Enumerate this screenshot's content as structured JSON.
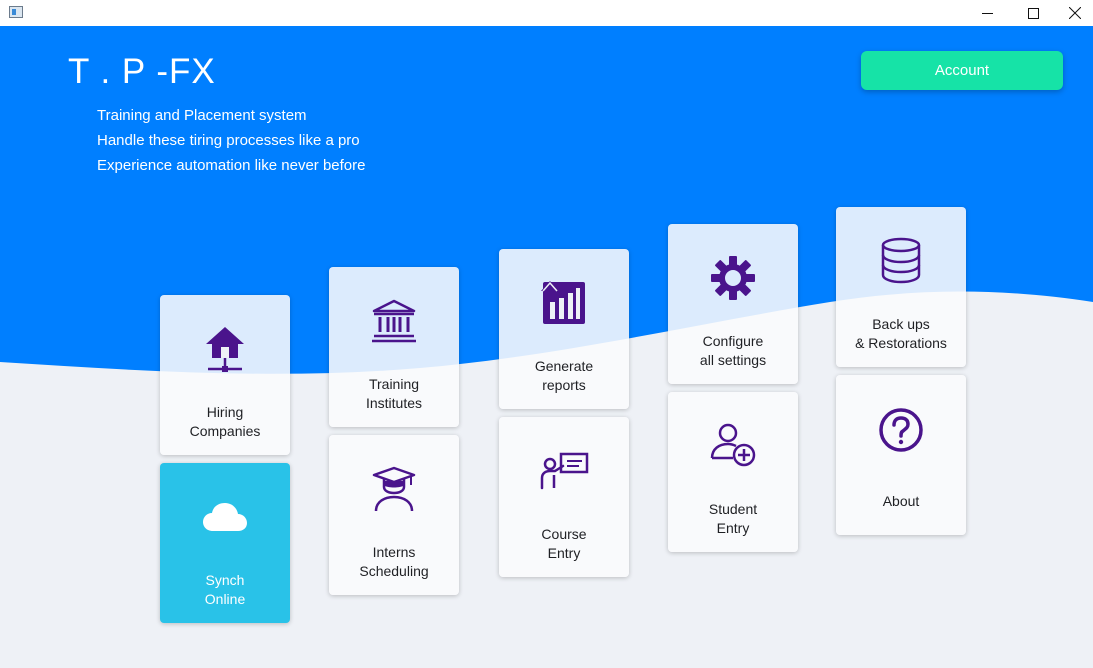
{
  "window": {
    "controls": [
      "minimize",
      "maximize",
      "close"
    ]
  },
  "header": {
    "brand": "T . P -FX",
    "taglines": [
      "Training and Placement system",
      "Handle these tiring processes like a pro",
      "Experience automation like never before"
    ],
    "account_label": "Account"
  },
  "colors": {
    "hero_blue": "#007fff",
    "background": "#eef1f6",
    "accent_green": "#16e3a7",
    "synch_blue": "#29c2e8",
    "icon_purple": "#4a148c"
  },
  "tiles": [
    {
      "line1": "Hiring",
      "line2": "Companies",
      "icon": "home-network-icon"
    },
    {
      "line1": "Synch",
      "line2": "Online",
      "icon": "cloud-icon"
    },
    {
      "line1": "Training",
      "line2": "Institutes",
      "icon": "institution-icon"
    },
    {
      "line1": "Interns",
      "line2": "Scheduling",
      "icon": "graduate-icon"
    },
    {
      "line1": "Generate",
      "line2": "reports",
      "icon": "report-chart-icon"
    },
    {
      "line1": "Course",
      "line2": "Entry",
      "icon": "presentation-icon"
    },
    {
      "line1": "Configure",
      "line2": "all settings",
      "icon": "gear-icon"
    },
    {
      "line1": "Student",
      "line2": "Entry",
      "icon": "add-user-icon"
    },
    {
      "line1": "Back ups",
      "line2": "& Restorations",
      "icon": "database-icon"
    },
    {
      "line1": "About",
      "line2": "",
      "icon": "help-icon"
    }
  ]
}
